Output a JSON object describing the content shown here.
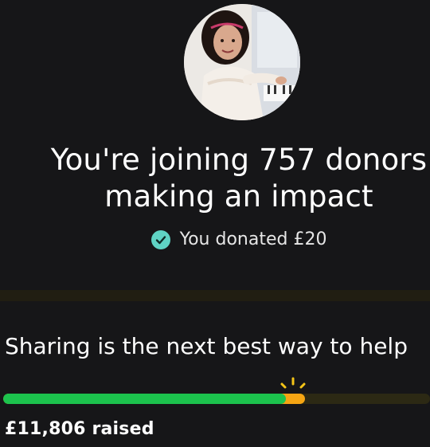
{
  "header": {
    "headline": "You're joining 757 donors making an impact",
    "confirmation": "You donated £20"
  },
  "share": {
    "title": "Sharing is the next best way to help"
  },
  "progress": {
    "raised_text": "£11,806 raised",
    "fraction_before_donation": 0.662,
    "fraction_after_donation": 0.707,
    "colors": {
      "before": "#1cc34d",
      "new_donation": "#f5a513",
      "track": "#2c2914"
    }
  },
  "icons": {
    "confirm": "check-circle-icon",
    "avatar": "beneficiary-photo"
  }
}
